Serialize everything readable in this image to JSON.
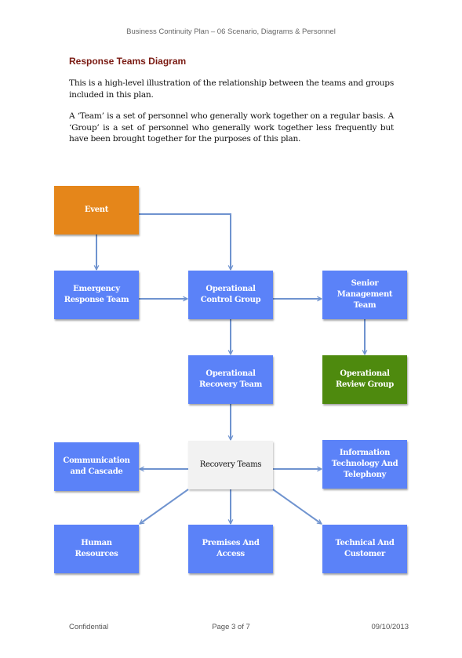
{
  "header": {
    "title": "Business Continuity Plan – 06 Scenario, Diagrams & Personnel"
  },
  "section": {
    "title": "Response Teams Diagram",
    "paragraphs": [
      "This is a high-level illustration of the relationship between the teams and groups included in this plan.",
      "A ‘Team’ is a set of personnel who generally work together on a regular basis. A ‘Group’ is a set of personnel who generally work together less frequently but have been brought together for the purposes of this plan."
    ]
  },
  "diagram": {
    "colors": {
      "event": "#E5861A",
      "team": "#5B82F8",
      "review": "#4E8A0E",
      "hub": "#F2F2F2",
      "connector": "#6F93CF"
    },
    "nodes": {
      "event": "Event",
      "emergency_response_team": "Emergency Response Team",
      "operational_control_group": "Operational Control Group",
      "senior_management_team": "Senior Management Team",
      "operational_recovery_team": "Operational Recovery Team",
      "operational_review_group": "Operational Review Group",
      "recovery_teams": "Recovery Teams",
      "communication_and_cascade": "Communication and Cascade",
      "information_technology": "Information Technology And Telephony",
      "human_resources": "Human Resources",
      "premises_and_access": "Premises And Access",
      "technical_and_customer": "Technical And Customer"
    },
    "edges": [
      [
        "event",
        "emergency_response_team"
      ],
      [
        "event",
        "operational_control_group"
      ],
      [
        "emergency_response_team",
        "operational_control_group"
      ],
      [
        "operational_control_group",
        "senior_management_team"
      ],
      [
        "operational_control_group",
        "operational_recovery_team"
      ],
      [
        "senior_management_team",
        "operational_review_group"
      ],
      [
        "operational_recovery_team",
        "recovery_teams"
      ],
      [
        "recovery_teams",
        "communication_and_cascade"
      ],
      [
        "recovery_teams",
        "information_technology"
      ],
      [
        "recovery_teams",
        "human_resources"
      ],
      [
        "recovery_teams",
        "premises_and_access"
      ],
      [
        "recovery_teams",
        "technical_and_customer"
      ]
    ]
  },
  "footer": {
    "left": "Confidential",
    "center": "Page 3 of 7",
    "right": "09/10/2013"
  }
}
